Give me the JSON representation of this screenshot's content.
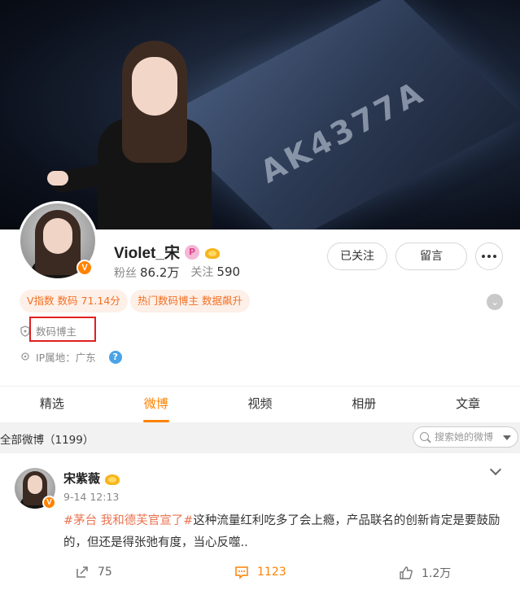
{
  "banner": {
    "chip_text": "AK4377A"
  },
  "profile": {
    "name": "Violet_宋",
    "fans_label": "粉丝",
    "fans_value": "86.2万",
    "follow_label": "关注",
    "follow_value": "590",
    "verified_badge": "V",
    "pink_badge": "P"
  },
  "buttons": {
    "followed": "已关注",
    "message": "留言"
  },
  "tags": [
    "V指数 数码 71.14分",
    "热门数码博主 数据飙升"
  ],
  "info": {
    "category": "数码博主",
    "ip": "IP属地：广东",
    "help_mark": "?"
  },
  "tabs": [
    "精选",
    "微博",
    "视频",
    "相册",
    "文章"
  ],
  "active_tab": "微博",
  "feed": {
    "title": "全部微博（1199）",
    "search_placeholder": "搜索她的微博"
  },
  "post": {
    "author": "宋紫薇",
    "time": "9-14 12:13",
    "topic": "#茅台 我和德芙官宣了#",
    "text": "这种流量红利吃多了会上瘾，产品联名的创新肯定是要鼓励的，但还是得张弛有度，当心反噬..",
    "reposts": "75",
    "comments": "1123",
    "likes": "1.2万"
  },
  "colors": {
    "accent": "#ff8200",
    "tag_text": "#f36f22",
    "topic": "#eb7350",
    "highlight_box": "#e02020"
  }
}
